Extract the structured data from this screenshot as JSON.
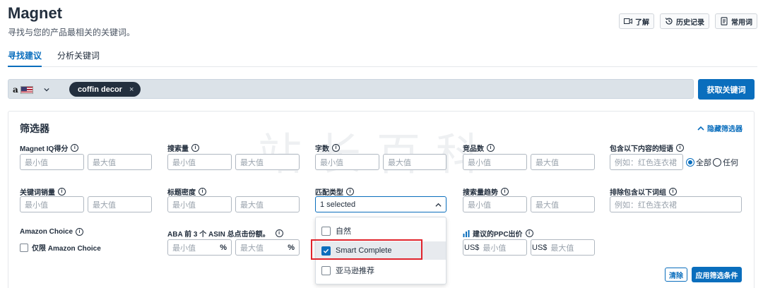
{
  "header": {
    "title": "Magnet",
    "subtitle": "寻找与您的产品最相关的关键词。",
    "actions": [
      {
        "label": "了解",
        "icon": "video-icon"
      },
      {
        "label": "历史记录",
        "icon": "history-icon"
      },
      {
        "label": "常用词",
        "icon": "document-icon"
      }
    ]
  },
  "tabs": [
    {
      "label": "寻找建议",
      "active": true
    },
    {
      "label": "分析关键词",
      "active": false
    }
  ],
  "search": {
    "marketplace_logo": "a",
    "keyword_chip": "coffin decor",
    "chip_remove": "×",
    "submit_label": "获取关键词"
  },
  "filters": {
    "title": "筛选器",
    "hide_label": "隐藏筛选器",
    "min_placeholder": "最小值",
    "max_placeholder": "最大值",
    "magnet_iq": "Magnet IQ得分",
    "search_volume": "搜索量",
    "word_count": "字数",
    "competing_products": "竞品数",
    "contains_phrase": "包含以下内容的短语",
    "phrase_placeholder": "例如：红色连衣裙",
    "radio_all": "全部",
    "radio_any": "任何",
    "keyword_sales": "关键词销量",
    "title_density": "标题密度",
    "match_type": "匹配类型",
    "match_selected": "1 selected",
    "search_trend": "搜索量趋势",
    "exclude_phrase": "排除包含以下词组",
    "amazon_choice": "Amazon Choice",
    "amazon_choice_only": "仅限 Amazon Choice",
    "aba_share": "ABA 前 3 个 ASIN 总点击份额。",
    "percent": "%",
    "ppc_bid": "建议的PPC出价",
    "currency": "US$",
    "clear": "清除",
    "apply": "应用筛选条件"
  },
  "match_options": [
    {
      "label": "自然",
      "checked": false
    },
    {
      "label": "Smart Complete",
      "checked": true
    },
    {
      "label": "亚马逊推荐",
      "checked": false
    }
  ],
  "watermark": "站长百科",
  "colors": {
    "accent": "#0a6ebd",
    "highlight": "#e0242c",
    "text": "#232f3e"
  }
}
